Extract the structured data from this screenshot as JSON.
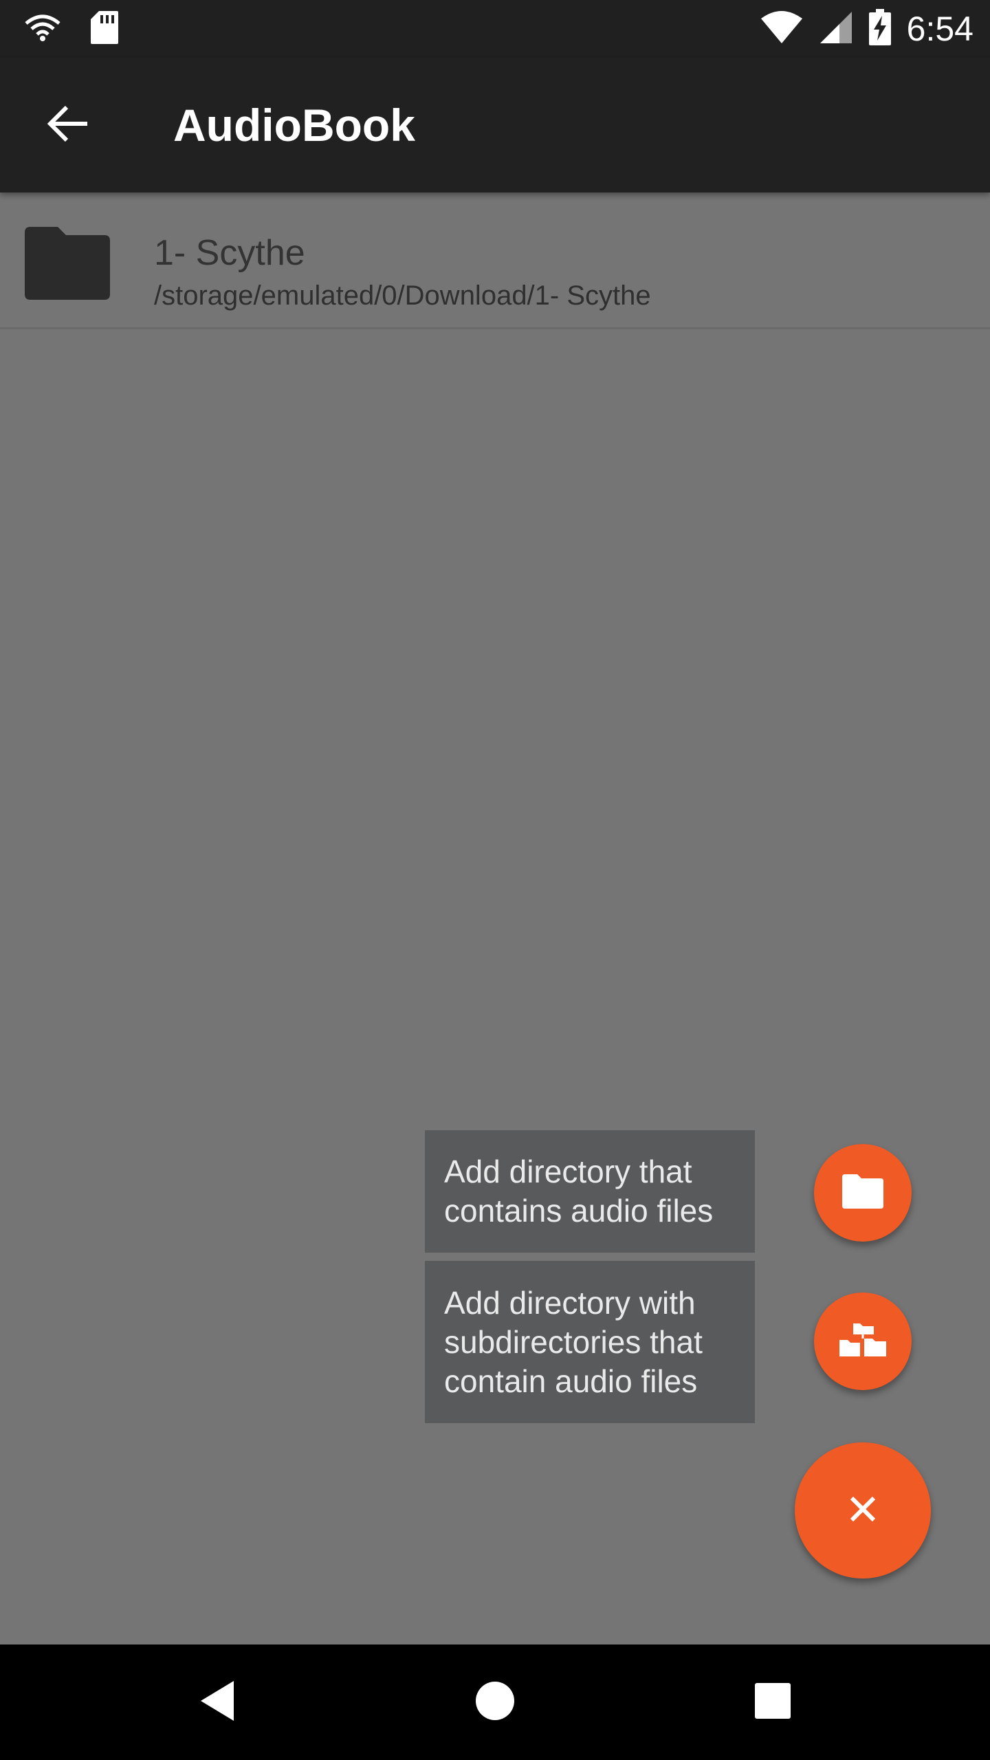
{
  "status_bar": {
    "time": "6:54",
    "icons": [
      "hotspot-icon",
      "sd-card-icon",
      "wifi-icon",
      "signal-icon",
      "battery-charging-icon"
    ]
  },
  "app_bar": {
    "title": "AudioBook",
    "back_icon": "arrow-back-icon"
  },
  "list": {
    "items": [
      {
        "icon": "folder-icon",
        "title": "1- Scythe",
        "path": "/storage/emulated/0/Download/1- Scythe"
      }
    ]
  },
  "fab_menu": {
    "options": [
      {
        "icon": "folder-icon",
        "label_lines": [
          "Add directory that",
          "contains audio files"
        ]
      },
      {
        "icon": "folder-tree-icon",
        "label_lines": [
          "Add directory with",
          "subdirectories that",
          "contain audio files"
        ]
      }
    ],
    "main_icon": "close-icon"
  },
  "colors": {
    "accent": "#f05a24",
    "app_bar": "#212121",
    "scrim_background": "#757575"
  },
  "nav_bar": {
    "icons": [
      "back-triangle-icon",
      "home-circle-icon",
      "recents-square-icon"
    ]
  }
}
